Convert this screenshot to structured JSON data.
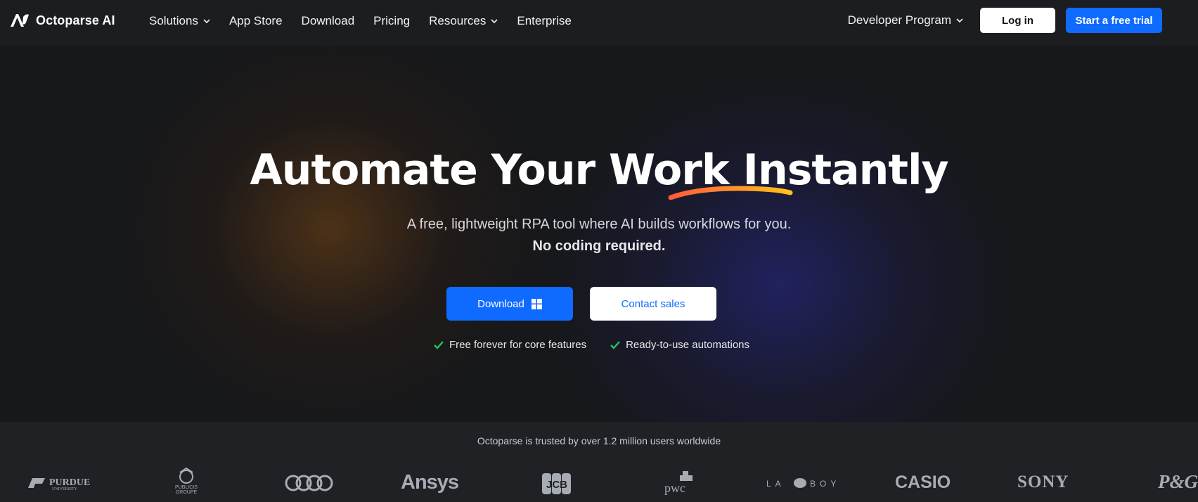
{
  "nav": {
    "logo_text": "Octoparse AI",
    "links": [
      {
        "label": "Solutions",
        "dropdown": true
      },
      {
        "label": "App Store",
        "dropdown": false
      },
      {
        "label": "Download",
        "dropdown": false
      },
      {
        "label": "Pricing",
        "dropdown": false
      },
      {
        "label": "Resources",
        "dropdown": true
      },
      {
        "label": "Enterprise",
        "dropdown": false
      }
    ],
    "developer_program": "Developer Program",
    "login": "Log in",
    "trial": "Start a free trial"
  },
  "hero": {
    "headline": "Automate Your Work Instantly",
    "subtitle": "A free, lightweight RPA tool where AI builds workflows for you.",
    "subtitle_bold": "No coding required.",
    "download_button": "Download",
    "contact_button": "Contact sales",
    "features": [
      "Free forever for core features",
      "Ready-to-use automations"
    ]
  },
  "trust": {
    "text": "Octoparse is trusted by over 1.2 million users worldwide",
    "logos": [
      "PURDUE UNIVERSITY",
      "PUBLICIS GROUPE",
      "Audi",
      "Ansys",
      "JCB",
      "pwc",
      "LA-Z-BOY",
      "CASIO",
      "SONY",
      "P&G"
    ]
  },
  "colors": {
    "primary": "#0f6bff",
    "nav_bg": "#1c1d21",
    "hero_bg": "#17181b",
    "trust_bg": "#1f2125",
    "check": "#22c55e",
    "swoosh_start": "#ff5a3c",
    "swoosh_end": "#ffc21a"
  }
}
